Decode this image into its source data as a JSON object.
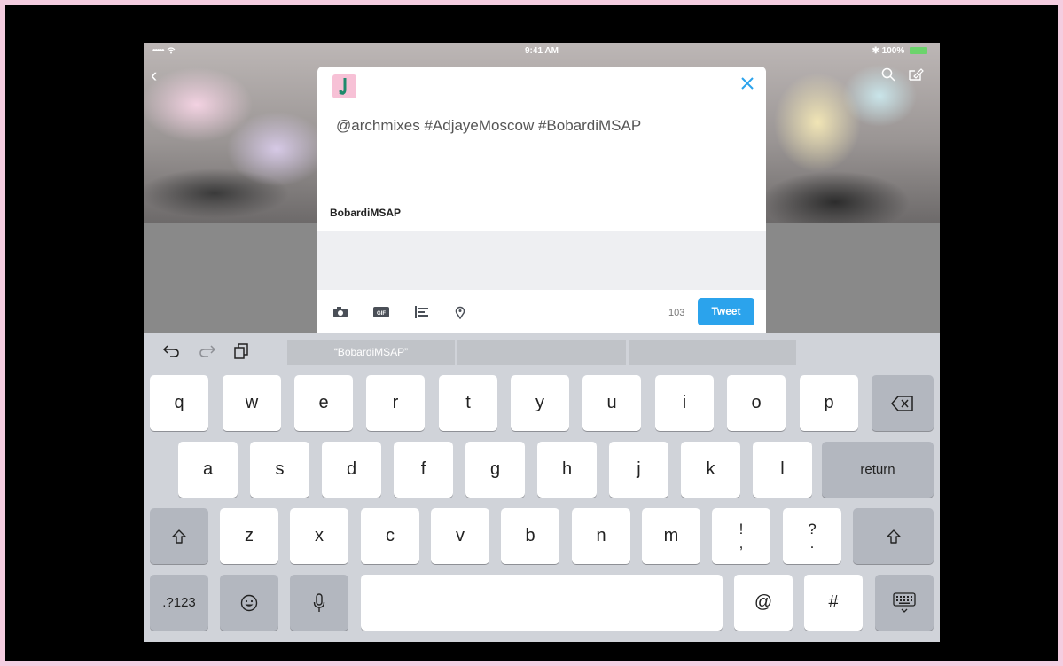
{
  "status_bar": {
    "signal": "•••••",
    "time": "9:41 AM",
    "battery_text": "100%"
  },
  "composer": {
    "tweet_text": "@archmixes #AdjayeMoscow #BobardiMSAP",
    "suggestion": "BobardiMSAP",
    "char_count": "103",
    "tweet_button": "Tweet"
  },
  "keyboard": {
    "predictions": [
      "“BobardiMSAP”",
      "",
      ""
    ],
    "row1": [
      "q",
      "w",
      "e",
      "r",
      "t",
      "y",
      "u",
      "i",
      "o",
      "p"
    ],
    "row2": [
      "a",
      "s",
      "d",
      "f",
      "g",
      "h",
      "j",
      "k",
      "l"
    ],
    "return": "return",
    "row3": [
      "z",
      "x",
      "c",
      "v",
      "b",
      "n",
      "m"
    ],
    "punct1": [
      "!",
      ","
    ],
    "punct2": [
      "?",
      "."
    ],
    "numbers": ".?123",
    "at": "@",
    "hash": "#"
  },
  "colors": {
    "accent": "#2ba3ec",
    "avatar_bg": "#f7c1d6",
    "frame_border": "#f4cde0"
  }
}
